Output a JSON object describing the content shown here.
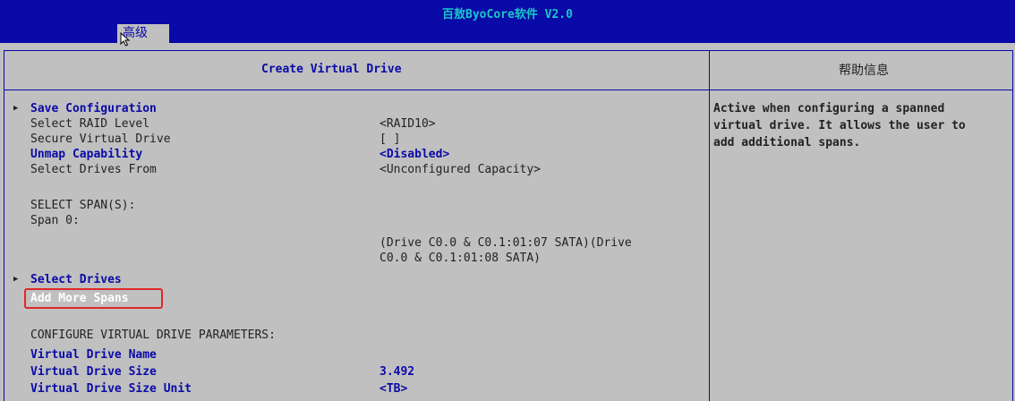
{
  "app_title": "百敖ByoCore软件 V2.0",
  "menu_tab": "高级",
  "panel_title": "Create Virtual Drive",
  "help_title": "帮助信息",
  "items": {
    "save_configuration": "Save Configuration",
    "select_raid_level": {
      "label": "Select RAID Level",
      "value": "<RAID10>"
    },
    "secure_virtual_drive": {
      "label": "Secure Virtual Drive",
      "value": "[ ]"
    },
    "unmap_capability": {
      "label": "Unmap Capability",
      "value": "<Disabled>"
    },
    "select_drives_from": {
      "label": "Select Drives From",
      "value": "<Unconfigured Capacity>"
    },
    "select_spans_heading": "SELECT SPAN(S):",
    "span0": {
      "label": "Span 0:",
      "value_line1": "(Drive C0.0 & C0.1:01:07 SATA)(Drive",
      "value_line2": "C0.0 & C0.1:01:08 SATA)"
    },
    "select_drives": "Select Drives",
    "add_more_spans": "Add More Spans",
    "configure_heading": "CONFIGURE VIRTUAL DRIVE PARAMETERS:",
    "virtual_drive_name": "Virtual Drive Name",
    "virtual_drive_size": {
      "label": "Virtual Drive Size",
      "value": "3.492"
    },
    "virtual_drive_size_unit": {
      "label": "Virtual Drive Size Unit",
      "value": "<TB>"
    }
  },
  "help_text": [
    "Active when configuring a spanned",
    "virtual drive. It allows the user to",
    "add additional spans."
  ],
  "colors": {
    "title_bar": "#0a0aa8",
    "background": "#c0c0c0",
    "selectable_text": "#0a0aa8",
    "highlight_border": "#e02828"
  }
}
